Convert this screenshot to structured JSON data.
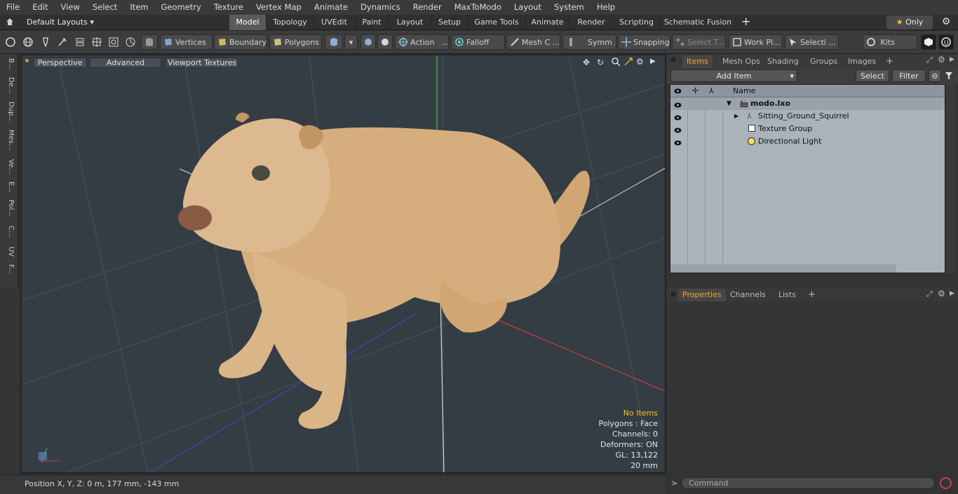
{
  "menu": [
    "File",
    "Edit",
    "View",
    "Select",
    "Item",
    "Geometry",
    "Texture",
    "Vertex Map",
    "Animate",
    "Dynamics",
    "Render",
    "MaxToModo",
    "Layout",
    "System",
    "Help"
  ],
  "layout_dropdown": "Default Layouts",
  "layout_tabs": [
    "Model",
    "Topology",
    "UVEdit",
    "Paint",
    "Layout",
    "Setup",
    "Game Tools",
    "Animate",
    "Render",
    "Scripting",
    "Schematic Fusion"
  ],
  "only_label": "Only",
  "toolbar": {
    "vertices": "Vertices",
    "boundary": "Boundary",
    "polygons": "Polygons",
    "action": "Action",
    "action_more": "...",
    "falloff": "Falloff",
    "mesh": "Mesh C ...",
    "symm": "Symm ...",
    "snapping": "Snapping",
    "select_t": "Select T...",
    "work_pl": "Work Pl...",
    "selecti": "Selecti ...",
    "kits": "Kits"
  },
  "left_tabs": [
    "B...",
    "De...",
    "Dup...",
    "Mes...",
    "Ve...",
    "E...",
    "Pol...",
    "C...",
    "UV",
    "F..."
  ],
  "viewport": {
    "perspective": "Perspective",
    "advanced": "Advanced",
    "textures": "Viewport Textures",
    "info": {
      "items": "No Items",
      "polygons": "Polygons : Face",
      "channels": "Channels: 0",
      "deformers": "Deformers: ON",
      "gl": "GL: 13,122",
      "scale": "20 mm"
    }
  },
  "status": {
    "position": "Position X, Y, Z:   0 m, 177 mm, -143 mm"
  },
  "right": {
    "tabs": [
      "Items",
      "Mesh Ops",
      "Shading",
      "Groups",
      "Images"
    ],
    "add_item": "Add Item",
    "select": "Select",
    "filter": "Filter",
    "col_name": "Name",
    "tree": [
      "modo.lxo",
      "Sitting_Ground_Squirrel",
      "Texture Group",
      "Directional Light"
    ],
    "bottom_tabs": [
      "Properties",
      "Channels",
      "Lists"
    ],
    "command_placeholder": "Command"
  },
  "colors": {
    "accent": "#f0a640",
    "info_yellow": "#f2c230",
    "grid_red": "#c84040",
    "grid_green": "#40c040",
    "grid_blue": "#4050d0",
    "squirrel": "#d6ad7c"
  }
}
